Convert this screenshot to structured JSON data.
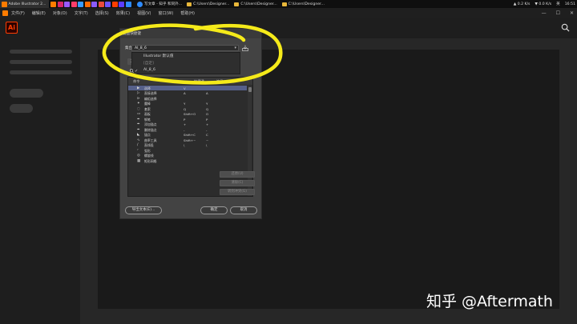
{
  "taskbar": {
    "app_title": "Adobe Illustrator 2...",
    "browser_tab": "写文章 - 知乎 和同外...",
    "folders": [
      "C:\\Users\\Designer...",
      "C:\\Users\\Designer...",
      "C:\\Users\\Designer..."
    ],
    "net_up": "▲ 0.2 K/s",
    "net_down": "▼ 0.0 K/s",
    "ime": "英",
    "time": "16:51",
    "app_icon_colors": [
      "#ff7c00",
      "#d8266a",
      "#9b59ff",
      "#ff3d6a",
      "#3a9bff",
      "#ff6a00",
      "#8c5bff",
      "#e84c3d",
      "#6a54ff",
      "#ff3d00",
      "#5c3dff",
      "#2e8bff"
    ]
  },
  "menubar": {
    "items": [
      "文件(F)",
      "编辑(E)",
      "对象(O)",
      "文字(T)",
      "选择(S)",
      "效果(C)",
      "视图(V)",
      "窗口(W)",
      "帮助(H)"
    ],
    "controls": [
      "—",
      "☐",
      "✕"
    ]
  },
  "app": {
    "logo": "Ai",
    "accent": "#ff3d00"
  },
  "dialog": {
    "title": "键盘快捷键",
    "preset_label": "集合(S):",
    "preset_value": "AI_8_6",
    "dropdown_options": [
      "Illustrator 默认值",
      "[自定]",
      "AI_8_6"
    ],
    "tab_label": "工具",
    "table": {
      "headers": [
        "命令",
        "快捷键",
        "符号"
      ],
      "rows": [
        {
          "name": "选择",
          "shortcut": "V",
          "symbol": ""
        },
        {
          "name": "直接选择",
          "shortcut": "A",
          "symbol": "A"
        },
        {
          "name": "编组选择",
          "shortcut": "",
          "symbol": ""
        },
        {
          "name": "魔棒",
          "shortcut": "Y",
          "symbol": "Y"
        },
        {
          "name": "套索",
          "shortcut": "Q",
          "symbol": "Q"
        },
        {
          "name": "画板",
          "shortcut": "Shift+O",
          "symbol": "O"
        },
        {
          "name": "钢笔",
          "shortcut": "P",
          "symbol": "P"
        },
        {
          "name": "添加锚点",
          "shortcut": "+",
          "symbol": "+"
        },
        {
          "name": "删除锚点",
          "shortcut": "-",
          "symbol": "-"
        },
        {
          "name": "锚点",
          "shortcut": "Shift+C",
          "symbol": "C"
        },
        {
          "name": "曲率工具",
          "shortcut": "Shift+~",
          "symbol": "~"
        },
        {
          "name": "直线段",
          "shortcut": "\\",
          "symbol": "\\"
        },
        {
          "name": "弧形",
          "shortcut": "",
          "symbol": ""
        },
        {
          "name": "螺旋线",
          "shortcut": "",
          "symbol": ""
        },
        {
          "name": "矩形网格",
          "shortcut": "",
          "symbol": ""
        }
      ]
    },
    "side_buttons": [
      "还原(U)",
      "清除(C)",
      "转到冲突(G)"
    ],
    "export_button": "导出文本(E)...",
    "ok_button": "确定",
    "cancel_button": "取消"
  },
  "watermark": "知乎 @Aftermath",
  "annotation_color": "#f5ea1a"
}
